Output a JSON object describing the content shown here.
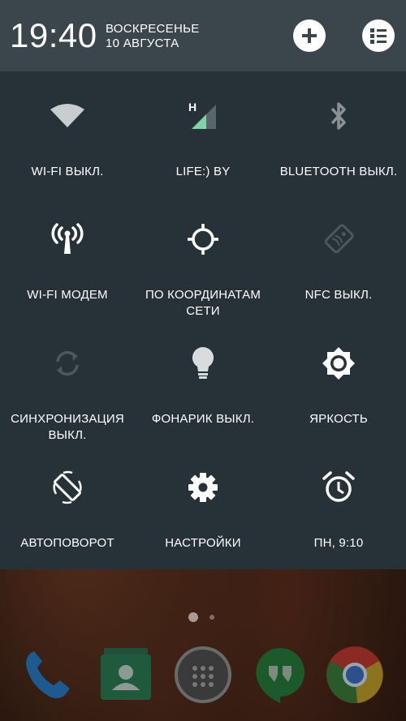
{
  "header": {
    "time": "19:40",
    "day": "ВОСКРЕСЕНЬЕ",
    "date": "10 АВГУСТА"
  },
  "tiles": [
    {
      "label": "WI-FI ВЫКЛ.",
      "icon": "wifi-icon"
    },
    {
      "label": "LIFE:) BY",
      "icon": "cellular-signal-icon"
    },
    {
      "label": "BLUETOOTH ВЫКЛ.",
      "icon": "bluetooth-icon"
    },
    {
      "label": "WI-FI МОДЕМ",
      "icon": "hotspot-icon"
    },
    {
      "label": "ПО КООРДИНАТАМ СЕТИ",
      "icon": "location-icon"
    },
    {
      "label": "NFC ВЫКЛ.",
      "icon": "nfc-icon"
    },
    {
      "label": "СИНХРОНИЗАЦИЯ ВЫКЛ.",
      "icon": "sync-icon"
    },
    {
      "label": "ФОНАРИК ВЫКЛ.",
      "icon": "flashlight-icon"
    },
    {
      "label": "ЯРКОСТЬ",
      "icon": "brightness-icon"
    },
    {
      "label": "АВТОПОВОРОТ",
      "icon": "auto-rotate-icon"
    },
    {
      "label": "НАСТРОЙКИ",
      "icon": "settings-icon"
    },
    {
      "label": "ПН, 9:10",
      "icon": "alarm-icon"
    }
  ],
  "signal_network_type": "H",
  "colors": {
    "header_bg": "#3b464c",
    "panel_bg": "#263238",
    "signal_accent": "#7fd3a8"
  }
}
